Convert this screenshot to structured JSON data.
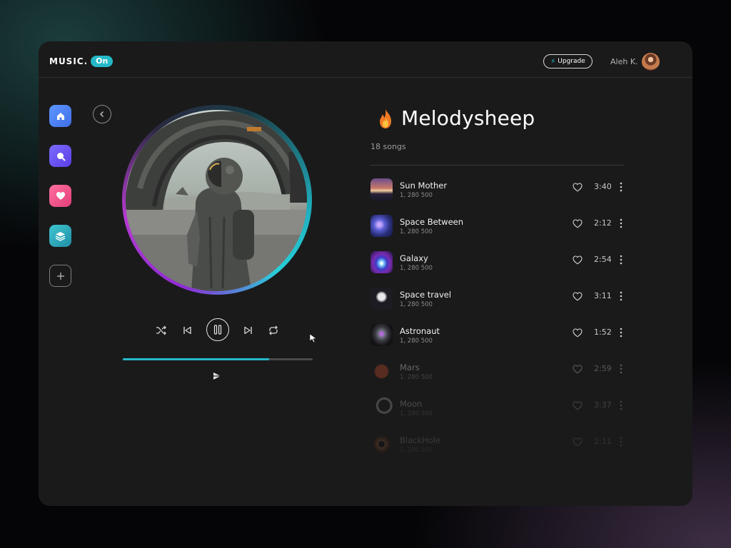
{
  "header": {
    "logo_text": "MUSIC.",
    "logo_badge": "On",
    "upgrade_label": "Upgrade",
    "user_name": "Aleh K."
  },
  "sidebar": {
    "items": [
      {
        "name": "home",
        "icon": "home-icon"
      },
      {
        "name": "search",
        "icon": "search-icon"
      },
      {
        "name": "favorites",
        "icon": "heart-icon"
      },
      {
        "name": "library",
        "icon": "layers-icon"
      },
      {
        "name": "add",
        "icon": "plus-icon"
      }
    ]
  },
  "player": {
    "progress": 0.77,
    "accent": "#25b9c8"
  },
  "playlist": {
    "title": "Melodysheep",
    "count": "18 songs",
    "songs": [
      {
        "title": "Sun Mother",
        "plays": "1, 280 500",
        "duration": "3:40"
      },
      {
        "title": "Space Between",
        "plays": "1, 280 500",
        "duration": "2:12"
      },
      {
        "title": "Galaxy",
        "plays": "1, 280 500",
        "duration": "2:54"
      },
      {
        "title": "Space travel",
        "plays": "1, 280 500",
        "duration": "3:11"
      },
      {
        "title": "Astronaut",
        "plays": "1, 280 500",
        "duration": "1:52"
      },
      {
        "title": "Mars",
        "plays": "1, 280 500",
        "duration": "2:59"
      },
      {
        "title": "Moon",
        "plays": "1, 280 500",
        "duration": "3:37"
      },
      {
        "title": "BlackHole",
        "plays": "1, 280 500",
        "duration": "2:11"
      }
    ]
  }
}
